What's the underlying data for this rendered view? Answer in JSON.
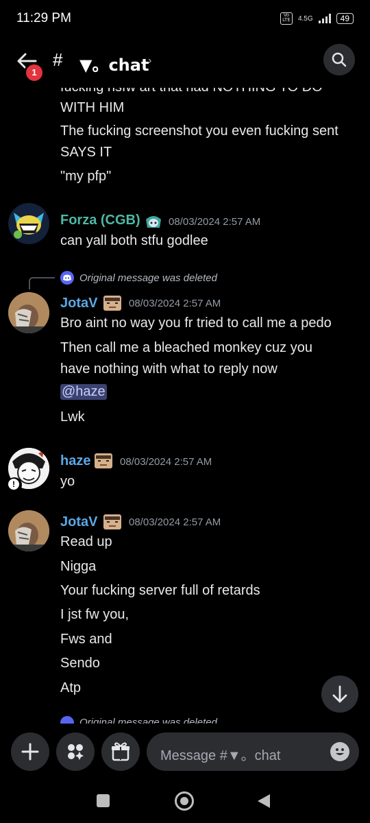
{
  "status": {
    "time": "11:29 PM",
    "volte": "Vo LTE",
    "network": "4.5G",
    "battery": "49"
  },
  "header": {
    "back_badge": "1",
    "hash": "#",
    "channel": "▼。chat",
    "chevron": "›"
  },
  "messages": {
    "cut_top": "fucking nsfw art that had NOTHING TO DO",
    "cont1": "WITH HIM",
    "cont2": "The fucking screenshot you even fucking sent",
    "cont3": "SAYS IT",
    "cont4": "\"my pfp\"",
    "forza": {
      "name": "Forza (CGB)",
      "time": "08/03/2024 2:57 AM",
      "text": "can yall both stfu godlee",
      "color": "#4fb8a6"
    },
    "reply1": "Original message was deleted",
    "jota1": {
      "name": "JotaV",
      "time": "08/03/2024 2:57 AM",
      "color": "#5ba8e6",
      "l1": "Bro aint no way you fr tried to call me a pedo",
      "l2": "Then call me a bleached monkey cuz you",
      "l3": "have nothing with what to reply now",
      "mention": "@haze",
      "l4": "Lwk"
    },
    "haze": {
      "name": "haze",
      "time": "08/03/2024 2:57 AM",
      "text": "yo",
      "color": "#5ba8e6"
    },
    "jota2": {
      "name": "JotaV",
      "time": "08/03/2024 2:57 AM",
      "l1": "Read up",
      "l2": "Nigga",
      "l3": "Your fucking server full of retards",
      "l4": "I jst fw you,",
      "l5": "Fws and",
      "l6": "Sendo",
      "l7": "Atp"
    },
    "reply2": "Original message was deleted"
  },
  "input": {
    "placeholder": "Message #▼。chat"
  }
}
